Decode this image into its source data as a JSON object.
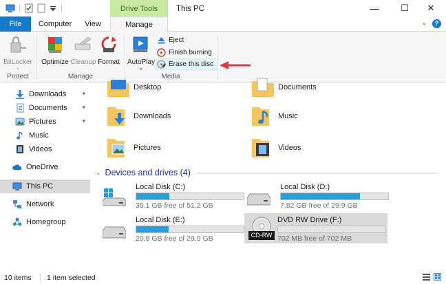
{
  "title_bar": {
    "contextual_tab": "Drive Tools",
    "window_title": "This PC",
    "controls": {
      "minimize": "—",
      "maximize": "☐",
      "close": "✕"
    }
  },
  "ribbon_tabs": {
    "file": "File",
    "computer": "Computer",
    "view": "View",
    "manage": "Manage",
    "collapse": "⌄",
    "help": "?"
  },
  "ribbon": {
    "protect": {
      "bitlocker": "BitLocker",
      "bitlocker_sub": "⌄",
      "label": "Protect"
    },
    "manage": {
      "optimize": "Optimize",
      "cleanup": "Cleanup",
      "format": "Format",
      "label": "Manage"
    },
    "media": {
      "autoplay": "AutoPlay",
      "autoplay_sub": "⌄",
      "eject": "Eject",
      "finish_burning": "Finish burning",
      "erase_disc": "Erase this disc",
      "label": "Media"
    }
  },
  "nav": {
    "items": [
      {
        "label": "Downloads",
        "icon": "download-arrow-icon",
        "pinned": true
      },
      {
        "label": "Documents",
        "icon": "documents-icon",
        "pinned": true
      },
      {
        "label": "Pictures",
        "icon": "pictures-icon",
        "pinned": true
      },
      {
        "label": "Music",
        "icon": "music-note-icon",
        "pinned": false
      },
      {
        "label": "Videos",
        "icon": "videos-icon",
        "pinned": false
      }
    ],
    "onedrive": "OneDrive",
    "thispc": "This PC",
    "network": "Network",
    "homegroup": "Homegroup",
    "pin_glyph": "📌"
  },
  "folders": {
    "desktop": "Desktop",
    "documents": "Documents",
    "downloads": "Downloads",
    "music": "Music",
    "pictures": "Pictures",
    "videos": "Videos"
  },
  "devices": {
    "header": "Devices and drives (4)",
    "chevron": "⌄",
    "drives": [
      {
        "name": "Local Disk (C:)",
        "free": "35.1 GB free of 51.2 GB",
        "used_fraction": 0.31
      },
      {
        "name": "Local Disk (D:)",
        "free": "7.82 GB free of 29.9 GB",
        "used_fraction": 0.74
      },
      {
        "name": "Local Disk (E:)",
        "free": "20.8 GB free of 29.9 GB",
        "used_fraction": 0.3
      },
      {
        "name": "DVD RW Drive (F:)",
        "free": "702 MB free of 702 MB",
        "used_fraction": 0.0,
        "badge": "CD-RW"
      }
    ]
  },
  "status": {
    "count": "10 items",
    "selection": "1 item selected"
  },
  "colors": {
    "accent": "#1979ca",
    "contextual": "#c9e8a2",
    "drive_bar": "#26a0da",
    "folder": "#f3c660",
    "arrow": "#e0393e"
  }
}
